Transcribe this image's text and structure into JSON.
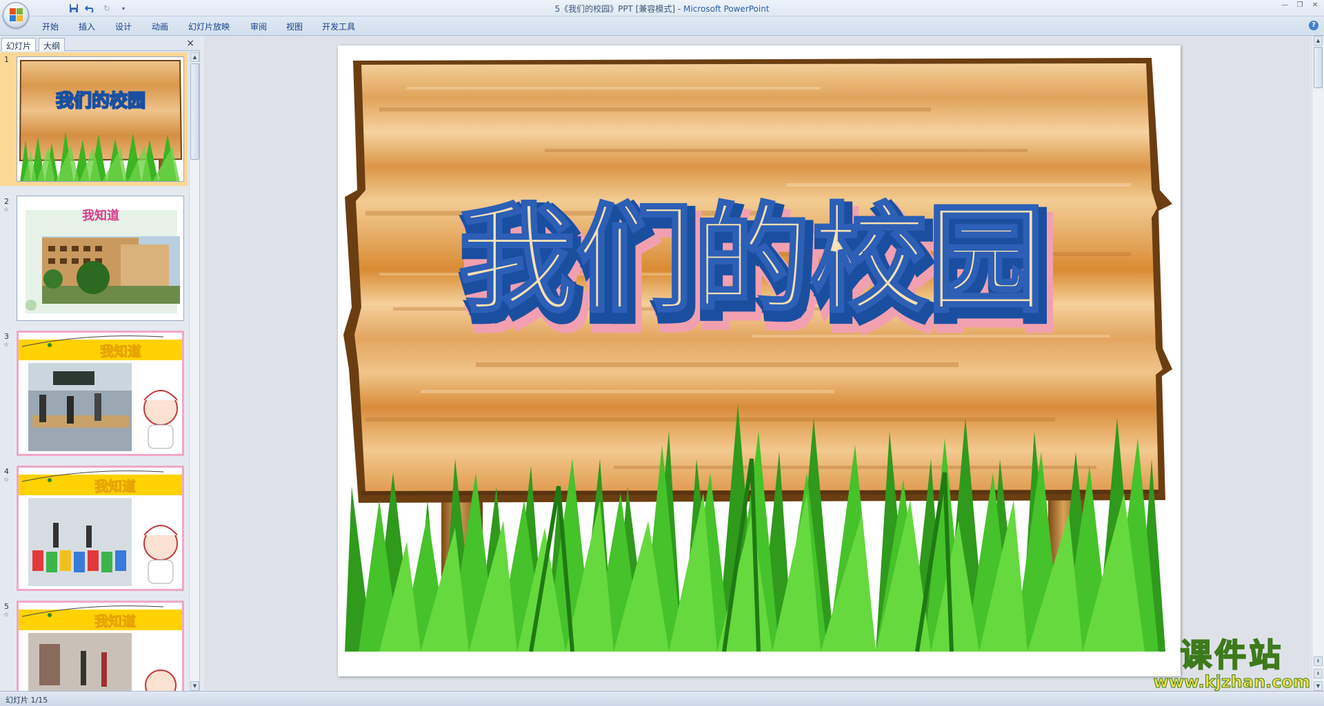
{
  "window": {
    "title": "5《我们的校园》PPT [兼容模式]",
    "title_separator": " - ",
    "app_name": "Microsoft PowerPoint"
  },
  "qat": {
    "save_icon": "save-icon",
    "undo_icon": "undo-icon",
    "redo_icon": "redo-icon",
    "more_icon": "customize-icon"
  },
  "ribbon": {
    "tabs": [
      "开始",
      "插入",
      "设计",
      "动画",
      "幻灯片放映",
      "审阅",
      "视图",
      "开发工具"
    ]
  },
  "pane": {
    "tabs": [
      "幻灯片",
      "大纲"
    ],
    "close": "×",
    "slides": [
      {
        "num": "1",
        "title": "我们的校园"
      },
      {
        "num": "2",
        "title": "我知道"
      },
      {
        "num": "3",
        "title": "我知道"
      },
      {
        "num": "4",
        "title": "我知道"
      },
      {
        "num": "5",
        "title": "我知道"
      }
    ]
  },
  "slide": {
    "title": "我们的校园"
  },
  "status": {
    "text": "幻灯片 1/15"
  },
  "watermark": {
    "main": "课件站",
    "url": "www.kjzhan.com"
  },
  "colors": {
    "wood": "#e0a45c",
    "grass": "#3bb521",
    "title_outline": "#1a4fa0",
    "selected": "#fbd896"
  }
}
